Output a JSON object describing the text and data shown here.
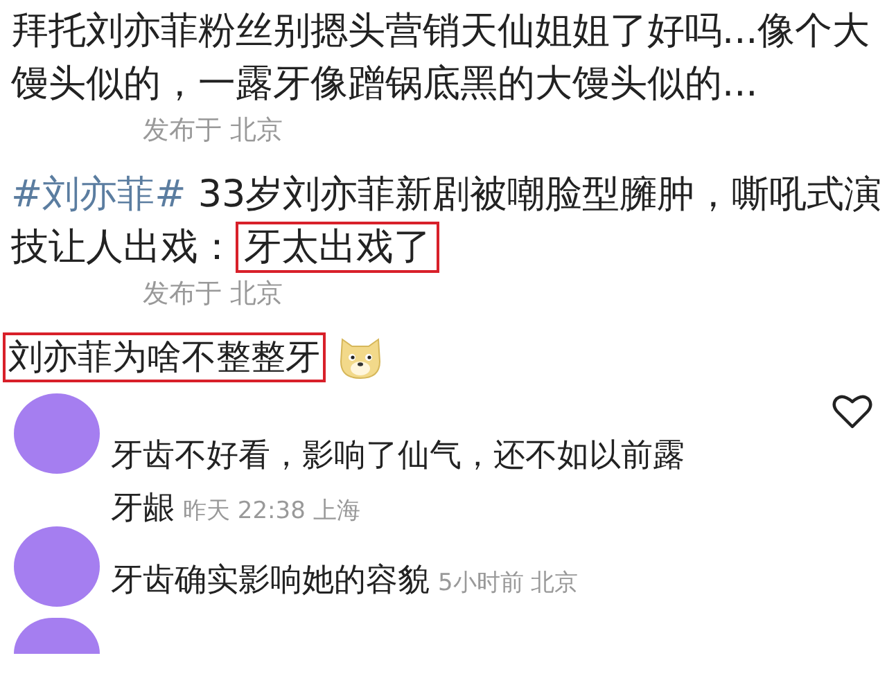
{
  "posts": [
    {
      "segments": [
        {
          "kind": "plain",
          "text": "拜托刘亦菲粉丝别摁头营销天仙姐姐了好吗...像个大馒头似的，一露牙像蹭锅底黑的大馒头似的..."
        }
      ],
      "meta": "发布于 北京"
    },
    {
      "segments": [
        {
          "kind": "hashtag",
          "text": "#刘亦菲#"
        },
        {
          "kind": "plain",
          "text": " 33岁刘亦菲新剧被嘲脸型臃肿，嘶吼式演技让人出戏："
        },
        {
          "kind": "boxed",
          "text": "牙太出戏了"
        }
      ],
      "meta": "发布于 北京"
    }
  ],
  "headline": {
    "text": "刘亦菲为啥不整整牙",
    "boxed": true
  },
  "comments": [
    {
      "text": "牙齿不好看，影响了仙气，还不如以前露牙龈",
      "meta": "昨天 22:38 上海",
      "like_button": true
    },
    {
      "text": "牙齿确实影响她的容貌",
      "meta": "5小时前 北京",
      "like_button": false
    }
  ],
  "more_comments_below": true
}
